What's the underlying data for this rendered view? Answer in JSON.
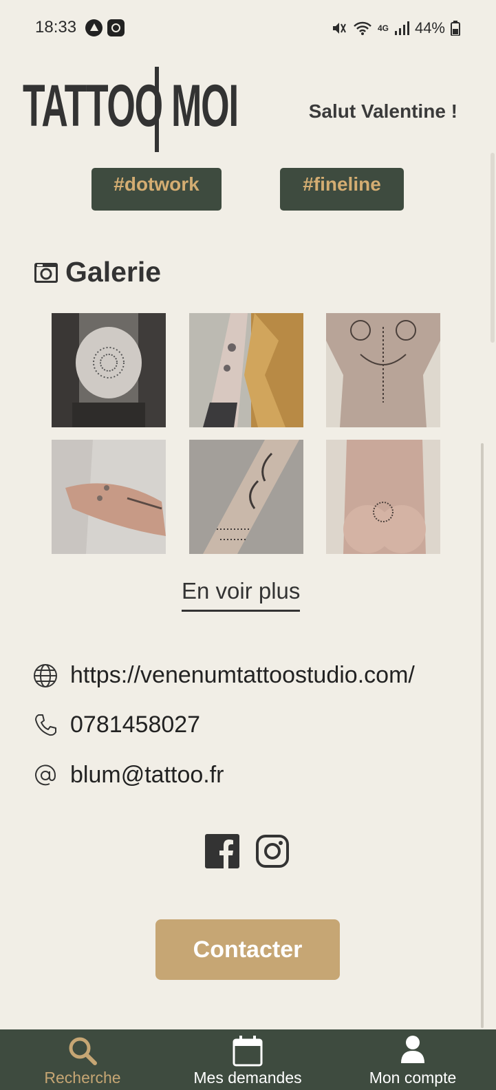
{
  "status_bar": {
    "time": "18:33",
    "network": "4G",
    "battery": "44%"
  },
  "header": {
    "logo_left": "TATTOO",
    "logo_right": "MOI",
    "greeting": "Salut Valentine !"
  },
  "tags": [
    "#dotwork",
    "#fineline"
  ],
  "gallery": {
    "title": "Galerie",
    "see_more": "En voir plus",
    "photo_count": 6
  },
  "contact": {
    "website": "https://venenumtattoostudio.com/",
    "phone": "0781458027",
    "email": "blum@tattoo.fr",
    "button_label": "Contacter"
  },
  "social": [
    "facebook-icon",
    "instagram-icon"
  ],
  "colors": {
    "background": "#f1eee6",
    "accent_dark": "#3e4b3f",
    "accent_gold": "#c6a674",
    "tag_text": "#d4ad72"
  },
  "bottom_nav": {
    "items": [
      {
        "label": "Recherche",
        "icon": "search-icon",
        "active": true
      },
      {
        "label": "Mes demandes",
        "icon": "calendar-icon",
        "active": false
      },
      {
        "label": "Mon compte",
        "icon": "user-icon",
        "active": false
      }
    ]
  }
}
